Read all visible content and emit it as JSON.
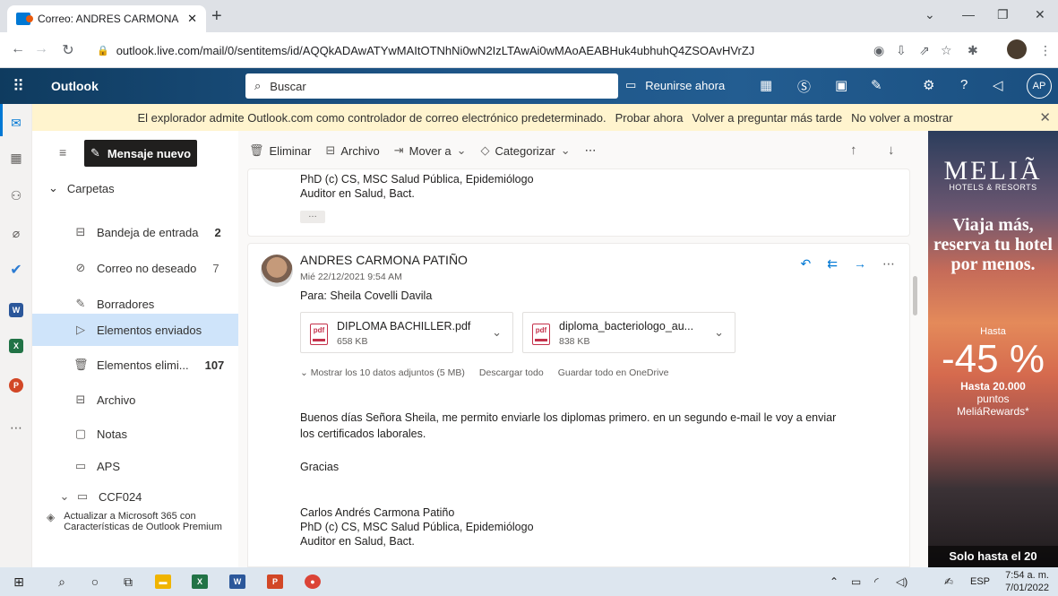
{
  "browser": {
    "tab_title": "Correo: ANDRES CARMONA PATI",
    "url": "outlook.live.com/mail/0/sentitems/id/AQQkADAwATYwMAItOTNhNi0wN2IzLTAwAi0wMAoAEABHuk4ubhuhQ4ZSOAvHVrZJ"
  },
  "header": {
    "app_name": "Outlook",
    "search_placeholder": "Buscar",
    "meet_now": "Reunirse ahora",
    "avatar_initials": "AP"
  },
  "banner": {
    "text": "El explorador admite Outlook.com como controlador de correo electrónico predeterminado.",
    "try_now": "Probar ahora",
    "ask_later": "Volver a preguntar más tarde",
    "never_show": "No volver a mostrar"
  },
  "folder_pane": {
    "new_message": "Mensaje nuevo",
    "folders_header": "Carpetas",
    "folders": [
      {
        "label": "Bandeja de entrada",
        "count": "2"
      },
      {
        "label": "Correo no deseado",
        "count": "7"
      },
      {
        "label": "Borradores",
        "count": ""
      },
      {
        "label": "Elementos enviados",
        "count": ""
      },
      {
        "label": "Elementos elimi...",
        "count": "107"
      },
      {
        "label": "Archivo",
        "count": ""
      },
      {
        "label": "Notas",
        "count": ""
      },
      {
        "label": "APS",
        "count": ""
      },
      {
        "label": "CCF024",
        "count": ""
      }
    ],
    "premium_text": "Actualizar a Microsoft 365 con Características de Outlook Premium"
  },
  "command_bar": {
    "delete": "Eliminar",
    "archive": "Archivo",
    "move_to": "Mover a",
    "categorize": "Categorizar"
  },
  "message_prev": {
    "sig_line1": "PhD (c) CS, MSC Salud Pública, Epidemiólogo",
    "sig_line2": "Auditor en Salud, Bact."
  },
  "message": {
    "sender": "ANDRES CARMONA PATIÑO",
    "date": "Mié 22/12/2021 9:54 AM",
    "to": "Para:  Sheila Covelli Davila",
    "attachments": [
      {
        "name": "DIPLOMA BACHILLER.pdf",
        "size": "658 KB"
      },
      {
        "name": "diploma_bacteriologo_au...",
        "size": "838 KB"
      }
    ],
    "show_all_attachments": "Mostrar los 10 datos adjuntos (5 MB)",
    "download_all": "Descargar todo",
    "save_onedrive": "Guardar todo en OneDrive",
    "body_line1": "Buenos días Señora Sheila, me permito enviarle los diplomas primero. en un segundo e-mail le voy a enviar",
    "body_line2": "los certificados laborales.",
    "thanks": "Gracias",
    "sig_name": "Carlos  Andrés Carmona Patiño",
    "sig_line1": "PhD (c) CS, MSC Salud Pública, Epidemiólogo",
    "sig_line2": "Auditor en Salud, Bact."
  },
  "ad": {
    "brand": "MELIÃ",
    "tagline": "HOTELS & RESORTS",
    "headline": "Viaja más, reserva tu hotel por menos.",
    "hasta": "Hasta",
    "discount": "-45 %",
    "points_line1": "Hasta 20.000",
    "points_line2": "puntos",
    "points_line3": "MeliáRewards*",
    "footer": "Solo hasta el 20"
  },
  "taskbar": {
    "lang": "ESP",
    "time": "7:54 a. m.",
    "date": "7/01/2022"
  }
}
